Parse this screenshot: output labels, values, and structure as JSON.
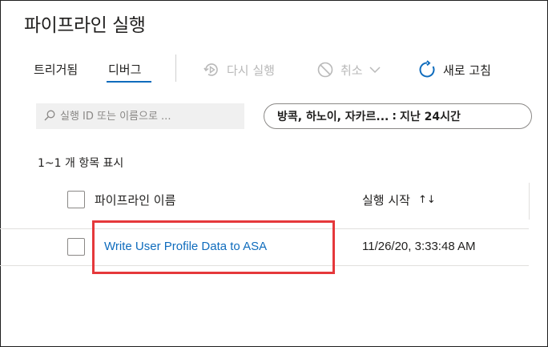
{
  "page": {
    "title": "파이프라인 실행"
  },
  "tabs": [
    {
      "label": "트리거됨",
      "selected": false
    },
    {
      "label": "디버그",
      "selected": true
    }
  ],
  "toolbar": {
    "rerun_label": "다시 실행",
    "cancel_label": "취소",
    "refresh_label": "새로 고침"
  },
  "search": {
    "placeholder": "실행 ID 또는 이름으로 ...",
    "value": ""
  },
  "filter": {
    "timezone": "방콕, 하노이, 자카르...",
    "separator": ":",
    "range": "지난 24시간"
  },
  "results": {
    "count_text": "1~1 개 항목 표시"
  },
  "table": {
    "columns": {
      "name": "파이프라인 이름",
      "run_start": "실행 시작"
    },
    "rows": [
      {
        "name": "Write User Profile Data to ASA",
        "run_start": "11/26/20, 3:33:48 AM"
      }
    ]
  },
  "colors": {
    "accent": "#0f6cbd",
    "highlight": "#e5383b",
    "disabled": "#b9b9b9"
  },
  "icons": {
    "rerun": "rerun-icon",
    "cancel": "cancel-icon",
    "refresh": "refresh-icon",
    "search": "search-icon",
    "sort": "sort-icon"
  }
}
